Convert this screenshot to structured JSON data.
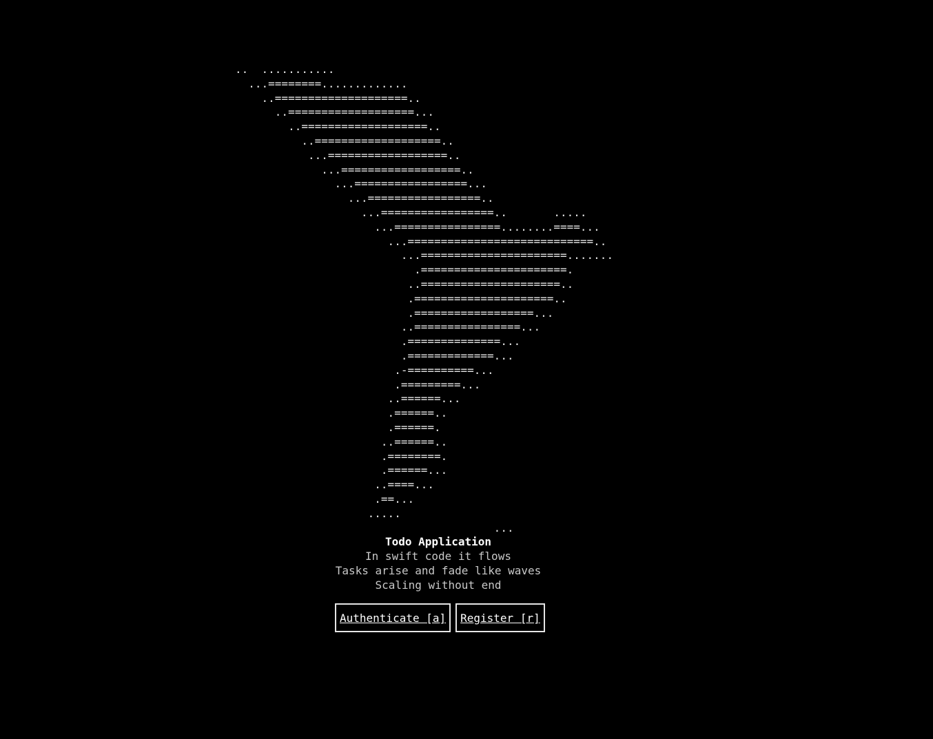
{
  "ascii_art": [
    "..  ...........",
    "  ...========.............",
    "    ..====================..",
    "      ..===================...",
    "        ..===================..",
    "          ..===================..",
    "           ...==================..",
    "             ...==================..",
    "               ...=================...",
    "                 ...=================..",
    "                   ...=================..       .....",
    "                     ...================........====...",
    "                       ...============================..",
    "                         ...======================.......",
    "                           .======================.",
    "                          ..=====================..",
    "                          .=====================..",
    "                          .==================...",
    "                         ..================...",
    "                         .==============...",
    "                         .=============...",
    "                        .-==========...",
    "                        .=========...",
    "                       ..======...",
    "                       .======..",
    "                       .======.",
    "                      ..======..",
    "                      .========.",
    "                      .======...",
    "                     ..====...",
    "                     .==...",
    "                    .....",
    "                                       ..."
  ],
  "app": {
    "title": "Todo Application",
    "haiku": [
      "In swift code it flows",
      "Tasks arise and fade like waves",
      "Scaling without end"
    ]
  },
  "buttons": {
    "authenticate": "Authenticate [a]",
    "register": "Register [r]"
  },
  "colors": {
    "background": "#000000",
    "text": "#d0d0d0",
    "title": "#ffffff",
    "button_border": "#e6e6e6"
  }
}
